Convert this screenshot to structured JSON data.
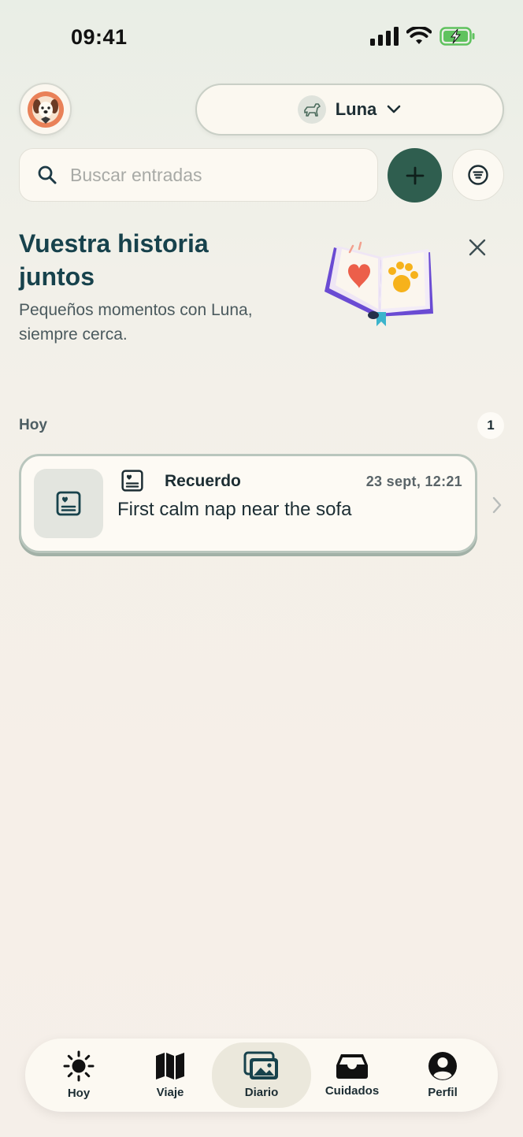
{
  "status_bar": {
    "time": "09:41",
    "icons": [
      "signal-icon",
      "wifi-icon",
      "battery-charging-icon"
    ]
  },
  "header": {
    "avatar_icon": "dog-avatar-icon",
    "pet_selector": {
      "pet_name": "Luna",
      "pet_icon": "dog-icon",
      "chevron_icon": "chevron-down-icon"
    }
  },
  "search": {
    "placeholder": "Buscar entradas",
    "icon": "search-icon",
    "add_icon": "plus-icon",
    "filter_icon": "filter-icon"
  },
  "hero": {
    "title": "Vuestra historia juntos",
    "subtitle": "Pequeños momentos con Luna, siempre cerca.",
    "illustration": "open-book-heart-paw-icon",
    "close_icon": "close-icon"
  },
  "section": {
    "label": "Hoy",
    "count": "1"
  },
  "entries": [
    {
      "type": "Recuerdo",
      "type_icon": "memory-card-icon",
      "date": "23 sept, 12:21",
      "title": "First calm nap near the sofa"
    }
  ],
  "bottom_nav": {
    "items": [
      {
        "label": "Hoy",
        "icon": "sun-icon",
        "active": false
      },
      {
        "label": "Viaje",
        "icon": "map-icon",
        "active": false
      },
      {
        "label": "Diario",
        "icon": "photos-icon",
        "active": true
      },
      {
        "label": "Cuidados",
        "icon": "inbox-icon",
        "active": false
      },
      {
        "label": "Perfil",
        "icon": "user-circle-icon",
        "active": false
      }
    ]
  },
  "colors": {
    "primary": "#2f5e4f",
    "title": "#17424c",
    "card_border": "#b9c6bd",
    "active_nav": "#ebe8dc"
  }
}
